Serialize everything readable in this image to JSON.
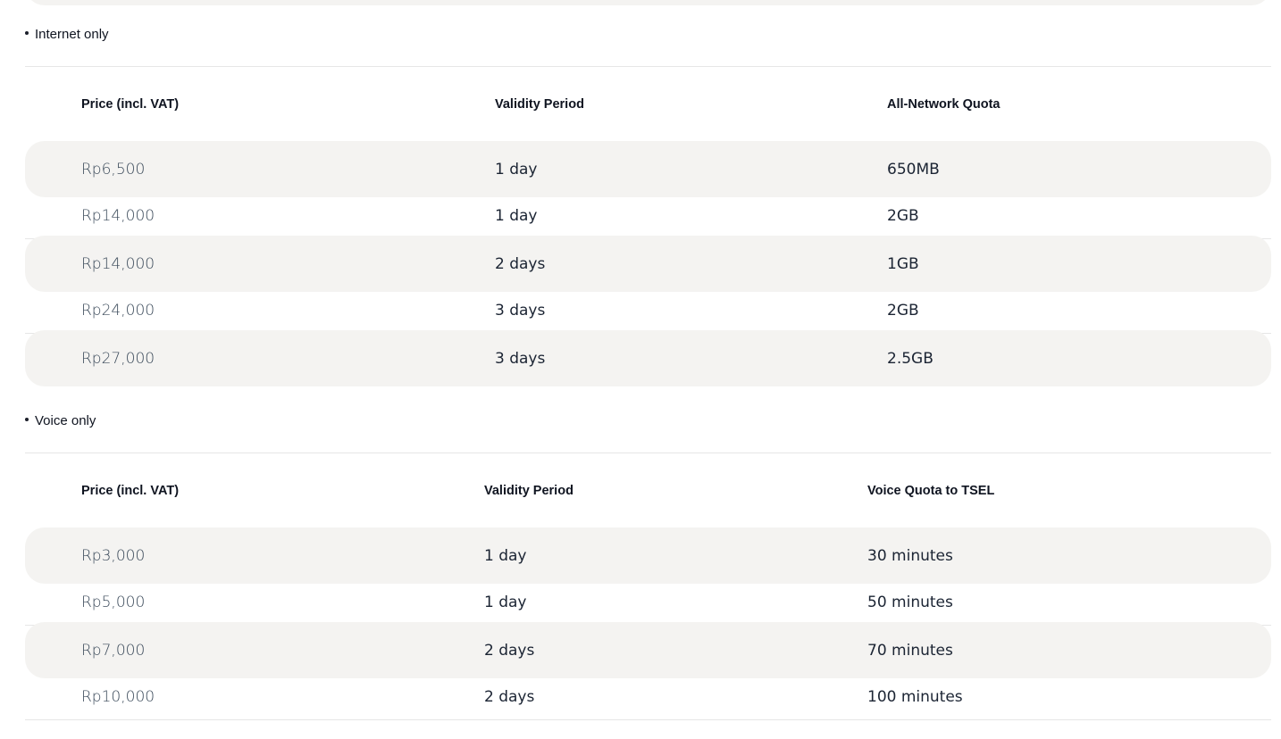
{
  "sections": [
    {
      "title": "Internet only",
      "headers": [
        "Price (incl. VAT)",
        "Validity Period",
        "All-Network Quota"
      ],
      "rows": [
        [
          "Rp6,500",
          "1 day",
          "650MB"
        ],
        [
          "Rp14,000",
          "1 day",
          "2GB"
        ],
        [
          "Rp14,000",
          "2 days",
          "1GB"
        ],
        [
          "Rp24,000",
          "3 days",
          "2GB"
        ],
        [
          "Rp27,000",
          "3 days",
          "2.5GB"
        ]
      ]
    },
    {
      "title": "Voice only",
      "headers": [
        "Price (incl. VAT)",
        "Validity Period",
        "Voice Quota to TSEL"
      ],
      "rows": [
        [
          "Rp3,000",
          "1 day",
          "30 minutes"
        ],
        [
          "Rp5,000",
          "1 day",
          "50 minutes"
        ],
        [
          "Rp7,000",
          "2 days",
          "70 minutes"
        ],
        [
          "Rp10,000",
          "2 days",
          "100 minutes"
        ]
      ]
    }
  ]
}
